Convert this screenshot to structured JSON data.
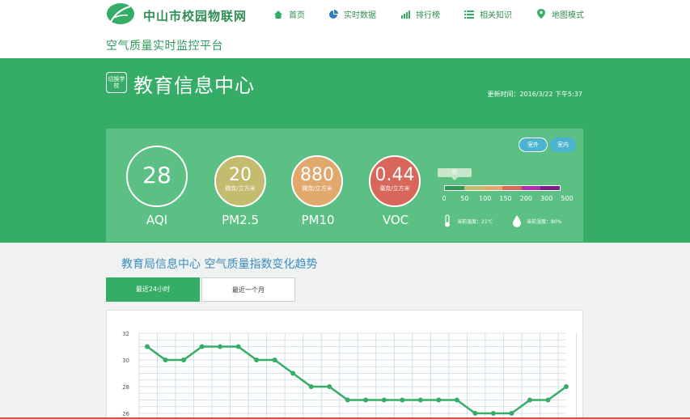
{
  "header": {
    "site_title": "中山市校园物联网",
    "subtitle": "空气质量实时监控平台",
    "nav": [
      {
        "label": "首页",
        "icon": "home-icon"
      },
      {
        "label": "实时数据",
        "icon": "pie-chart-icon"
      },
      {
        "label": "排行榜",
        "icon": "bar-chart-icon"
      },
      {
        "label": "相关知识",
        "icon": "list-icon"
      },
      {
        "label": "地图模式",
        "icon": "map-pin-icon"
      }
    ]
  },
  "banner": {
    "school_icon_text": "切换学校",
    "school_name": "教育信息中心",
    "update_time": "更新时间：2016/3/22 下午5:37",
    "toggle": {
      "outdoor": "室外",
      "indoor": "室内",
      "active": "outdoor"
    },
    "metrics": {
      "aqi": {
        "value": "28",
        "label": "AQI"
      },
      "pm25": {
        "value": "20",
        "unit": "微克/立方米",
        "label": "PM2.5"
      },
      "pm10": {
        "value": "880",
        "unit": "微克/立方米",
        "label": "PM10"
      },
      "voc": {
        "value": "0.44",
        "unit": "毫克/立方米",
        "label": "VOC"
      }
    },
    "scale": {
      "tag": "优",
      "ticks": [
        "0",
        "50",
        "100",
        "150",
        "200",
        "300",
        "500"
      ],
      "colors": [
        "#2e9a5a",
        "#c3bb6d",
        "#e0a86d",
        "#d8665a",
        "#b02bb8",
        "#7a1d8a"
      ]
    },
    "temperature": "当前温度：21℃",
    "humidity": "当前湿度：80%"
  },
  "trend": {
    "title": "教育局信息中心 空气质量指数变化趋势",
    "tabs": [
      {
        "label": "最近24小时",
        "active": true
      },
      {
        "label": "最近一个月",
        "active": false
      }
    ]
  },
  "chart_data": {
    "type": "line",
    "title": "",
    "xlabel": "",
    "ylabel": "",
    "ylim": [
      26,
      32
    ],
    "y_ticks": [
      "32",
      "30",
      "28",
      "26"
    ],
    "grid": true,
    "series": [
      {
        "values": [
          31,
          30,
          30,
          31,
          31,
          31,
          30,
          30,
          29,
          28,
          28,
          27,
          27,
          27,
          27,
          27,
          27,
          27,
          26,
          26,
          26,
          27,
          27,
          28
        ],
        "color": "#35ad67"
      }
    ]
  }
}
